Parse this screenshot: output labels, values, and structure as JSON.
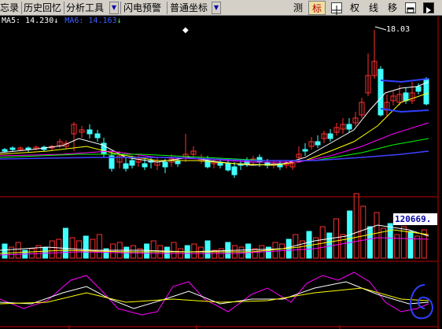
{
  "toolbar": {
    "items": [
      "忘录",
      "历史回忆",
      "分析工具",
      "闪电预警",
      "普通坐标"
    ],
    "buttons": [
      "测",
      "标",
      "权",
      "线",
      "移"
    ],
    "active_button": "标",
    "dropdown_glyph": "▼"
  },
  "legend": {
    "ma5_label": "MA5: 14.230",
    "ma5_arrow": "↓",
    "ma6_label": "MA6: 14.163",
    "ma6_arrow": "↓"
  },
  "price_annotation": "18.03",
  "volume_readout": "120669.",
  "colors": {
    "up": "#ff3030",
    "down": "#40ffff",
    "ma5": "#ffffff",
    "ma10": "#ffff00",
    "ma20": "#ff00ff",
    "ma30": "#00ff00",
    "ma60": "#4040ff",
    "grid": "#c00000"
  }
}
